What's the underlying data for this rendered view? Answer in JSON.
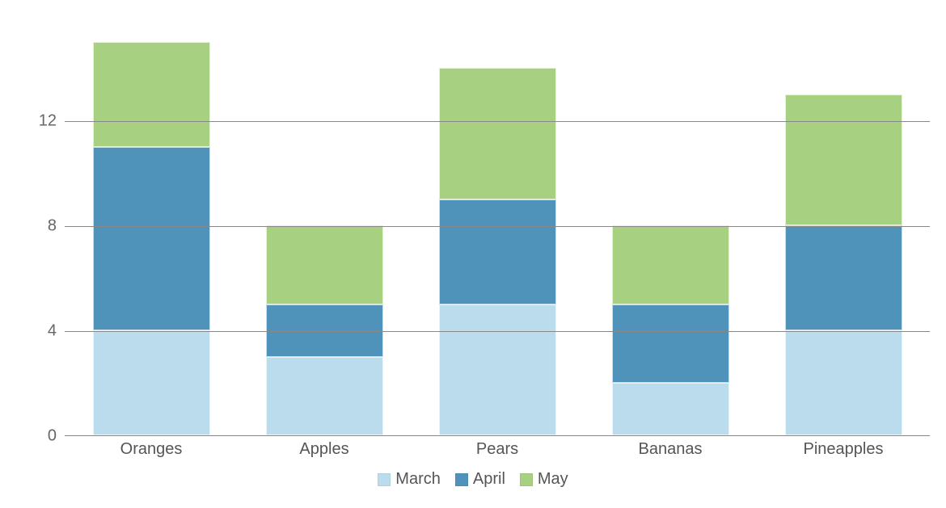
{
  "chart_data": {
    "type": "bar",
    "stacked": true,
    "categories": [
      "Oranges",
      "Apples",
      "Pears",
      "Bananas",
      "Pineapples"
    ],
    "series": [
      {
        "name": "March",
        "values": [
          4,
          3,
          5,
          2,
          4
        ]
      },
      {
        "name": "April",
        "values": [
          7,
          2,
          4,
          3,
          4
        ]
      },
      {
        "name": "May",
        "values": [
          4,
          3,
          5,
          3,
          5
        ]
      }
    ],
    "ylim": [
      0,
      16
    ],
    "yticks": [
      0,
      4,
      8,
      12
    ],
    "title": "",
    "xlabel": "",
    "ylabel": "",
    "colors": {
      "March": "#bbdcec",
      "April": "#4f93bb",
      "May": "#a7d080"
    },
    "legend_position": "bottom"
  }
}
